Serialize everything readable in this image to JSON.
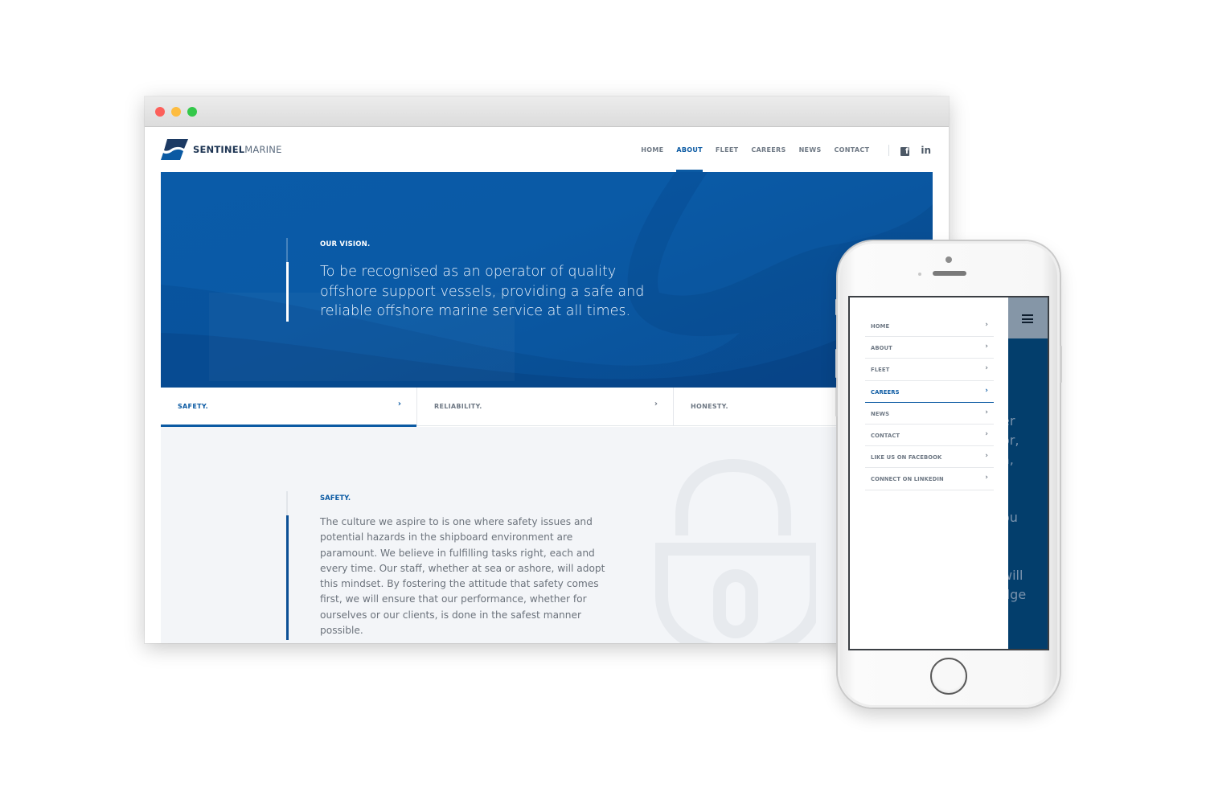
{
  "browser": {
    "window_controls": [
      "close",
      "minimize",
      "maximize"
    ]
  },
  "site": {
    "logo": {
      "bold": "SENTINEL",
      "light": "MARINE",
      "icon": "sentinel-wave-logo"
    },
    "nav": [
      {
        "label": "HOME",
        "active": false
      },
      {
        "label": "ABOUT",
        "active": true
      },
      {
        "label": "FLEET",
        "active": false
      },
      {
        "label": "CAREERS",
        "active": false
      },
      {
        "label": "NEWS",
        "active": false
      },
      {
        "label": "CONTACT",
        "active": false
      }
    ],
    "social": {
      "facebook": "f",
      "linkedin": "in"
    },
    "hero": {
      "label": "OUR VISION.",
      "text": "To be recognised as an operator of quality offshore support vessels, providing a safe and reliable offshore marine service at all times."
    },
    "tabs": [
      {
        "label": "SAFETY.",
        "active": true,
        "chevron": "›"
      },
      {
        "label": "RELIABILITY.",
        "active": false,
        "chevron": "›"
      },
      {
        "label": "HONESTY.",
        "active": false,
        "chevron": ""
      }
    ],
    "content": {
      "label": "SAFETY.",
      "text": "The culture we aspire to is one where safety issues and potential hazards in the shipboard environment are paramount. We believe in fulfilling tasks right, each and every time. Our staff, whether at sea or ashore, will adopt this mindset. By fostering the attitude that safety comes first, we will ensure that our performance, whether for ourselves or our clients, is done in the safest manner possible.",
      "icon": "padlock-icon"
    }
  },
  "mobile": {
    "menu": [
      {
        "label": "HOME",
        "active": false
      },
      {
        "label": "ABOUT",
        "active": false
      },
      {
        "label": "FLEET",
        "active": false
      },
      {
        "label": "CAREERS",
        "active": true
      },
      {
        "label": "NEWS",
        "active": false
      },
      {
        "label": "CONTACT",
        "active": false
      },
      {
        "label": "LIKE US ON FACEBOOK",
        "active": false
      },
      {
        "label": "CONNECT ON LINKEDIN",
        "active": false
      }
    ],
    "chevron": "›",
    "background_text": "er\nor,\na,\n\n\nou\n\n\nwill\ndge"
  },
  "colors": {
    "brand_blue": "#0b5aa3",
    "hero_blue": "#0a5aa6",
    "dark_blue": "#033e6c",
    "text_gray": "#6c737c",
    "nav_gray": "#6e7884",
    "content_bg": "#f3f5f8"
  }
}
